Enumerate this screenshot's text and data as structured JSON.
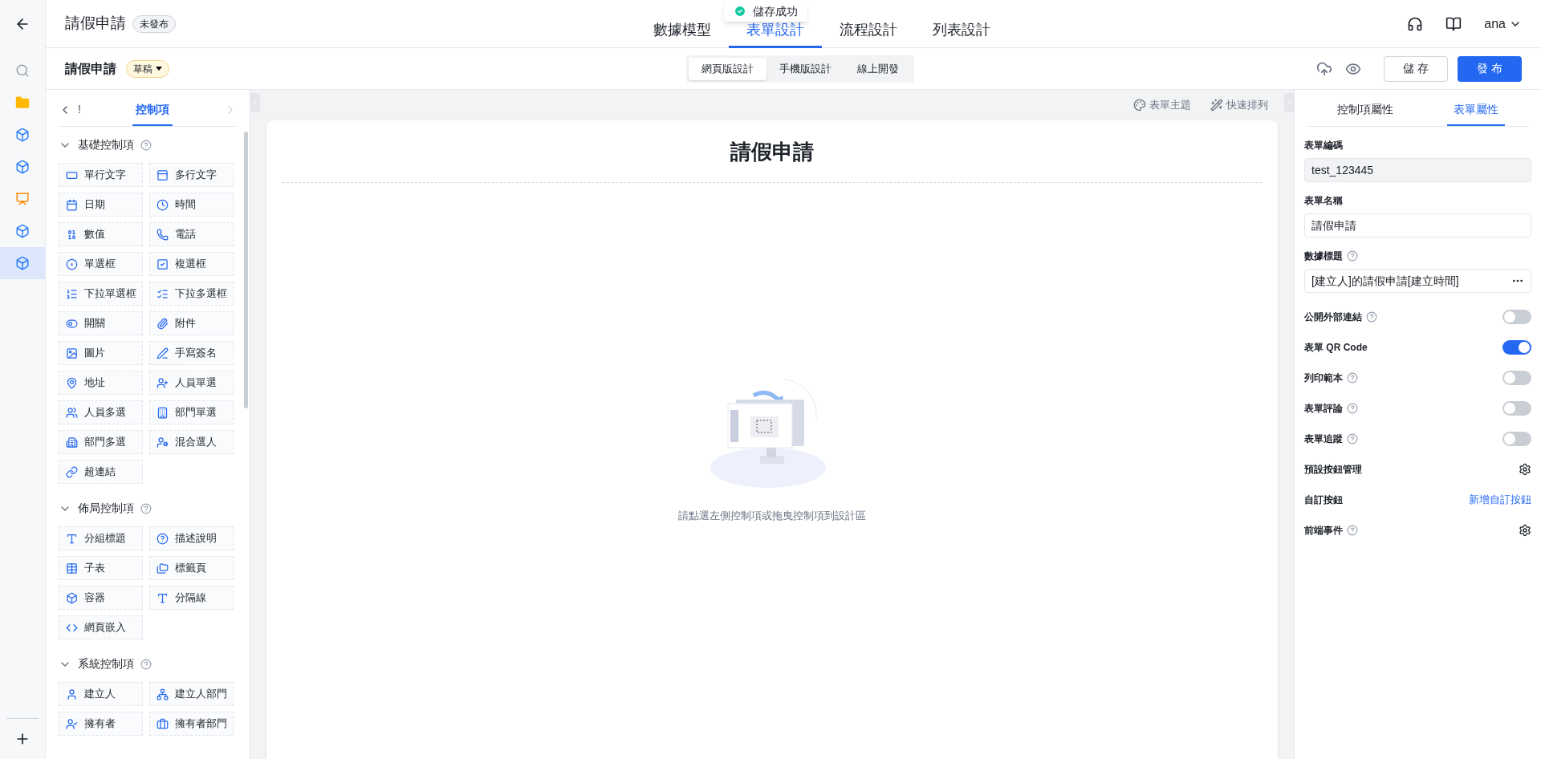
{
  "header": {
    "title": "請假申請",
    "status": "未發布",
    "tabs": [
      {
        "label": "數據模型",
        "selected": false
      },
      {
        "label": "表單設計",
        "selected": true
      },
      {
        "label": "流程設計",
        "selected": false
      },
      {
        "label": "列表設計",
        "selected": false
      }
    ],
    "toast": "儲存成功",
    "user": "ana"
  },
  "toolbar": {
    "title": "請假申請",
    "state": "草稿",
    "modes": [
      {
        "label": "網頁版設計",
        "selected": true
      },
      {
        "label": "手機版設計",
        "selected": false
      },
      {
        "label": "線上開發",
        "selected": false
      }
    ],
    "save": "儲 存",
    "publish": "發 布"
  },
  "rail": {
    "items": [
      {
        "kind": "search",
        "selected": false
      },
      {
        "kind": "folder",
        "selected": false
      },
      {
        "kind": "cube",
        "selected": false
      },
      {
        "kind": "cube",
        "selected": false
      },
      {
        "kind": "chart",
        "selected": false
      },
      {
        "kind": "cube",
        "selected": false
      },
      {
        "kind": "cube",
        "selected": true
      }
    ]
  },
  "left_panel": {
    "tabs": [
      {
        "label": "!",
        "selected": false
      },
      {
        "label": "控制項",
        "selected": true
      }
    ],
    "sections": [
      {
        "title": "基礎控制項",
        "expanded": true,
        "items": [
          "單行文字",
          "多行文字",
          "日期",
          "時間",
          "數值",
          "電話",
          "單選框",
          "複選框",
          "下拉單選框",
          "下拉多選框",
          "開關",
          "附件",
          "圖片",
          "手寫簽名",
          "地址",
          "人員單選",
          "人員多選",
          "部門單選",
          "部門多選",
          "混合選人",
          "超連結"
        ]
      },
      {
        "title": "佈局控制項",
        "expanded": true,
        "items": [
          "分組標題",
          "描述說明",
          "子表",
          "標籤頁",
          "容器",
          "分隔線",
          "網頁嵌入"
        ]
      },
      {
        "title": "系統控制項",
        "expanded": true,
        "items": [
          "建立人",
          "建立人部門",
          "擁有者",
          "擁有者部門"
        ]
      }
    ]
  },
  "canvas": {
    "actions": [
      "表單主題",
      "快速排列"
    ],
    "form_title": "請假申請",
    "empty_hint": "請點選左側控制項或拖曳控制項到設計區"
  },
  "right_panel": {
    "tabs": [
      {
        "label": "控制項屬性",
        "selected": false
      },
      {
        "label": "表單屬性",
        "selected": true
      }
    ],
    "fields": [
      {
        "label": "表單編碼",
        "value": "test_123445",
        "disabled": true,
        "help": false,
        "more": false
      },
      {
        "label": "表單名稱",
        "value": "請假申請",
        "disabled": false,
        "help": false,
        "more": false
      },
      {
        "label": "數據標題",
        "value": "[建立人]的請假申請[建立時間]",
        "disabled": false,
        "help": true,
        "more": true
      }
    ],
    "settings": [
      {
        "kind": "switch",
        "label": "公開外部連結",
        "help": true,
        "on": false
      },
      {
        "kind": "switch",
        "label": "表單 QR Code",
        "help": false,
        "on": true
      },
      {
        "kind": "switch",
        "label": "列印範本",
        "help": true,
        "on": false
      },
      {
        "kind": "switch",
        "label": "表單評論",
        "help": true,
        "on": false
      },
      {
        "kind": "switch",
        "label": "表單追蹤",
        "help": true,
        "on": false
      },
      {
        "kind": "gear",
        "label": "預設按鈕管理",
        "help": false
      },
      {
        "kind": "link",
        "label": "自訂按鈕",
        "help": false,
        "link": "新增自訂按鈕"
      },
      {
        "kind": "gear",
        "label": "前端事件",
        "help": true
      }
    ]
  }
}
